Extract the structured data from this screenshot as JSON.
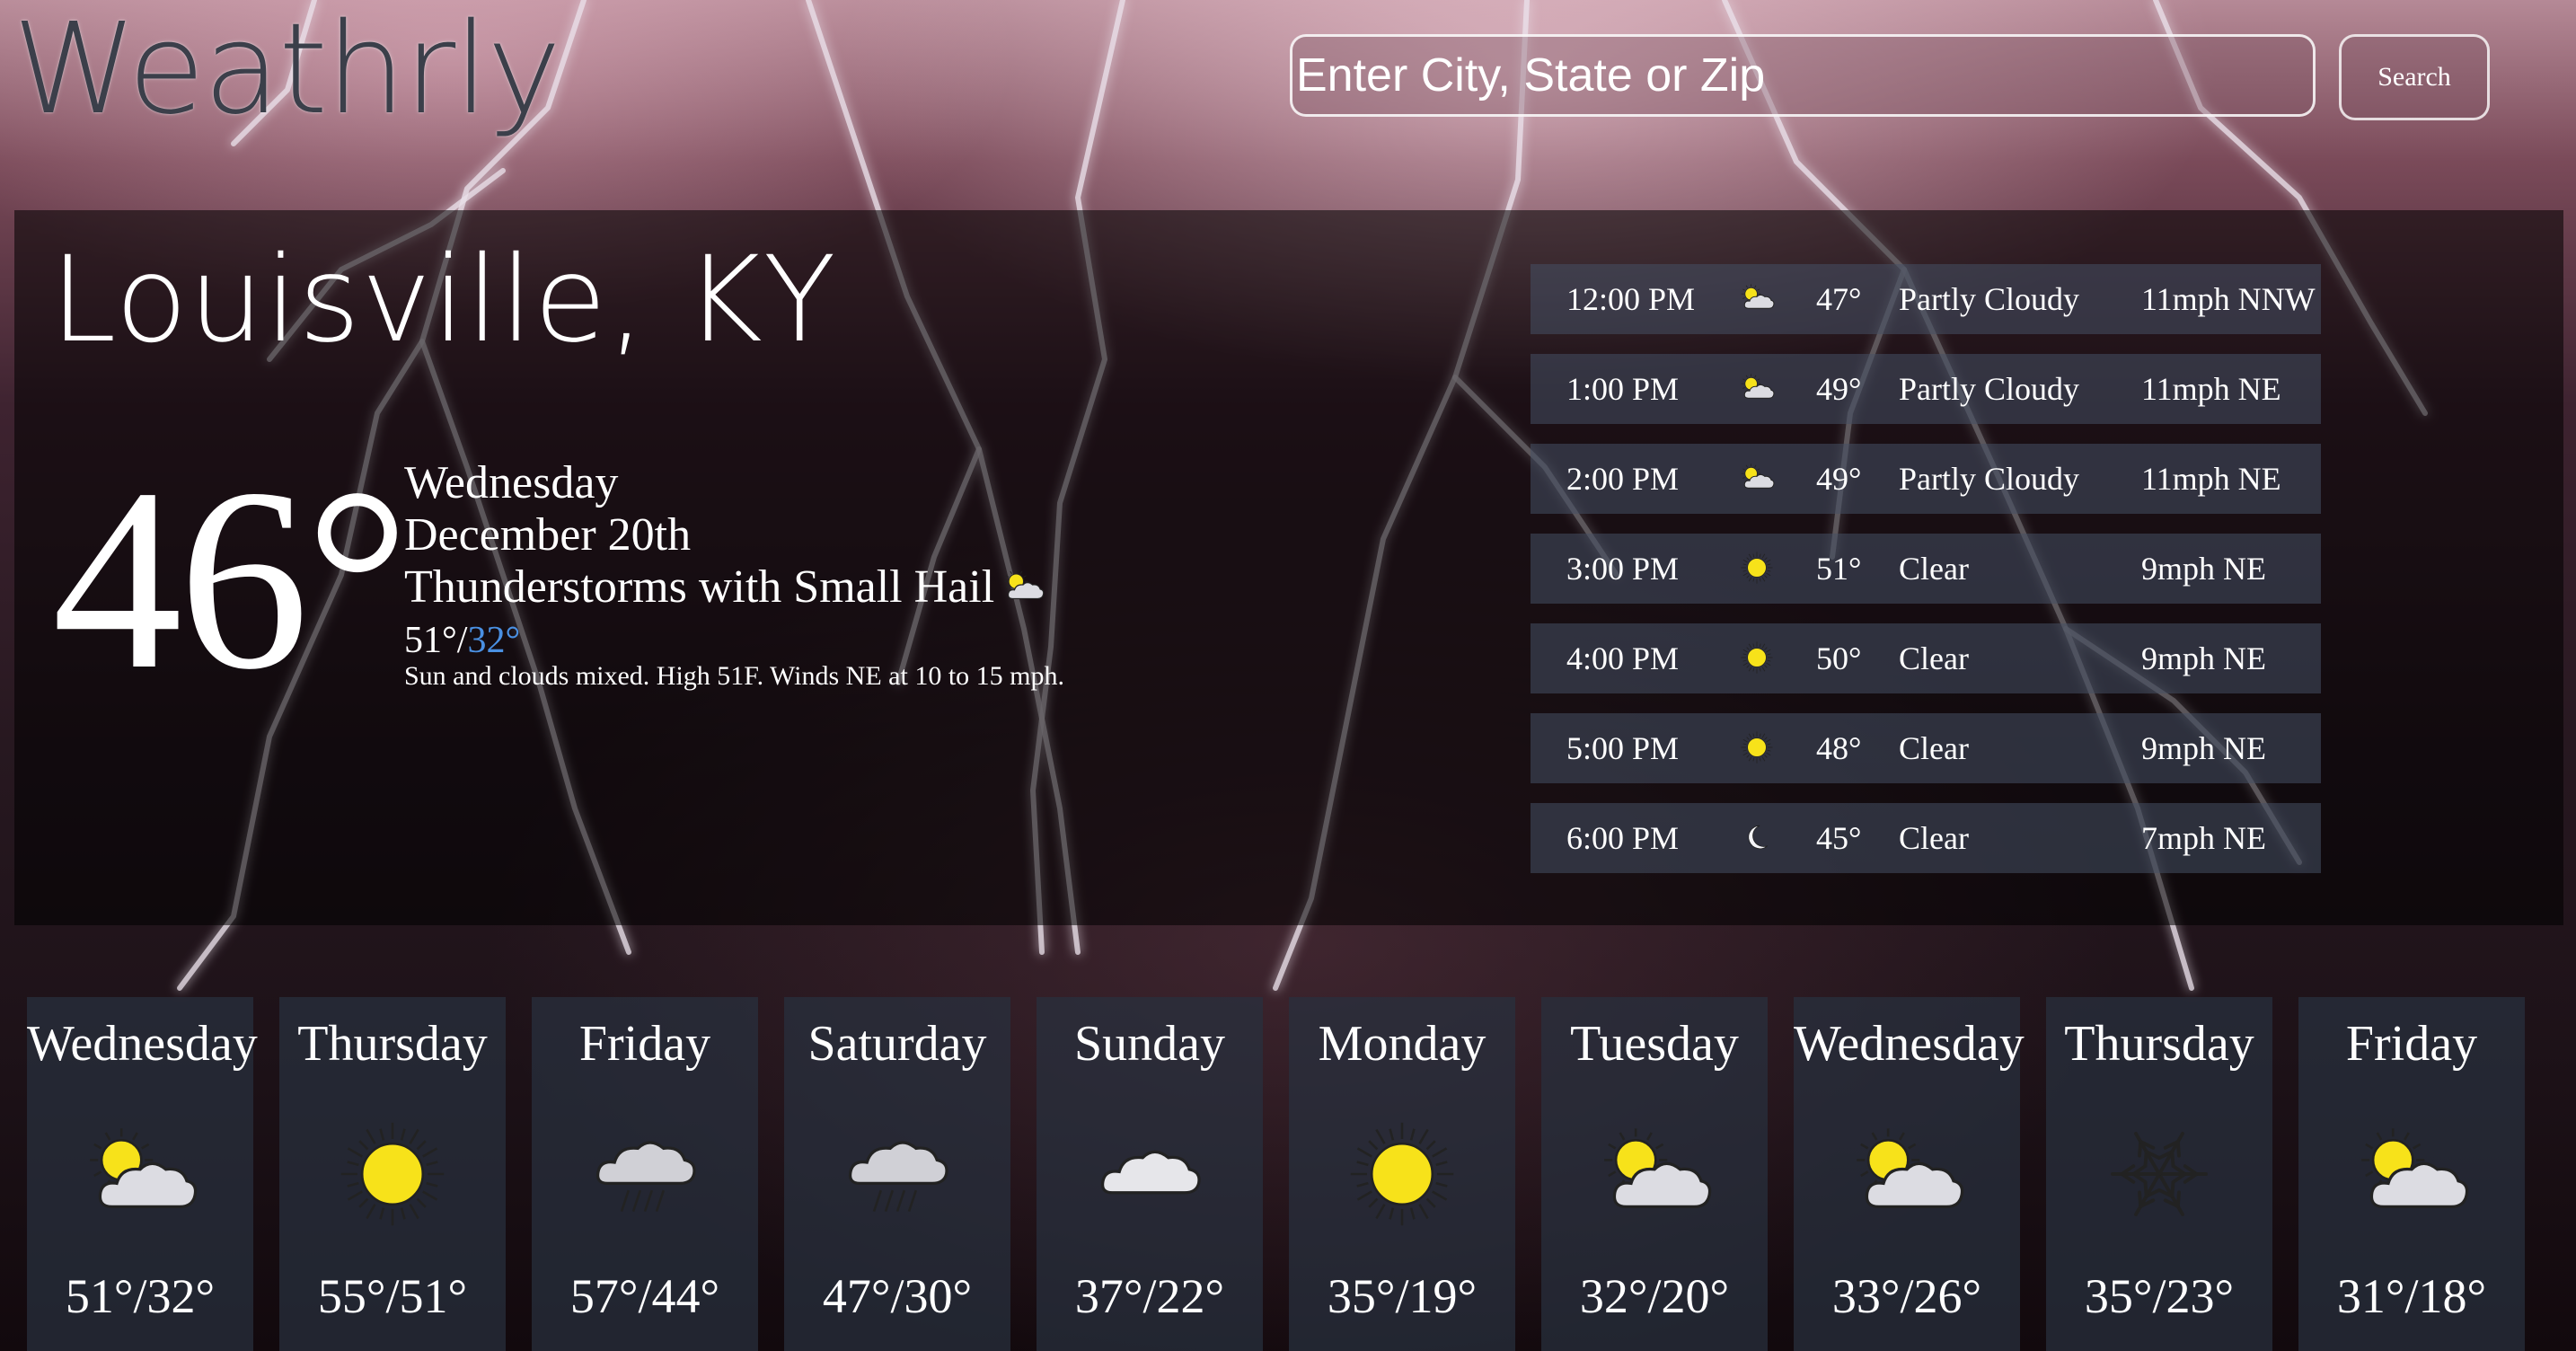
{
  "app": {
    "logo": "Weathrly"
  },
  "search": {
    "placeholder": "Enter City, State or Zip",
    "button_label": "Search"
  },
  "current": {
    "city": "Louisville, KY",
    "temp": "46°",
    "day": "Wednesday",
    "date": "December 20th",
    "condition": "Thunderstorms with Small Hail",
    "condition_icon": "partly-cloudy-icon",
    "high": "51°",
    "separator": "/",
    "low": "32°",
    "summary": "Sun and clouds mixed. High 51F. Winds NE at 10 to 15 mph.",
    "low_color": "#4a90e2"
  },
  "hourly": [
    {
      "time": "12:00 PM",
      "icon": "partly-cloudy-icon",
      "temp": "47°",
      "condition": "Partly Cloudy",
      "wind": "11mph NNW"
    },
    {
      "time": "1:00 PM",
      "icon": "partly-cloudy-icon",
      "temp": "49°",
      "condition": "Partly Cloudy",
      "wind": "11mph NE"
    },
    {
      "time": "2:00 PM",
      "icon": "partly-cloudy-icon",
      "temp": "49°",
      "condition": "Partly Cloudy",
      "wind": "11mph NE"
    },
    {
      "time": "3:00 PM",
      "icon": "sun-icon",
      "temp": "51°",
      "condition": "Clear",
      "wind": "9mph NE"
    },
    {
      "time": "4:00 PM",
      "icon": "sun-icon",
      "temp": "50°",
      "condition": "Clear",
      "wind": "9mph NE"
    },
    {
      "time": "5:00 PM",
      "icon": "sun-icon",
      "temp": "48°",
      "condition": "Clear",
      "wind": "9mph NE"
    },
    {
      "time": "6:00 PM",
      "icon": "moon-icon",
      "temp": "45°",
      "condition": "Clear",
      "wind": "7mph NE"
    }
  ],
  "daily": [
    {
      "day": "Wednesday",
      "icon": "partly-cloudy-icon",
      "temps": "51°/32°"
    },
    {
      "day": "Thursday",
      "icon": "sun-icon",
      "temps": "55°/51°"
    },
    {
      "day": "Friday",
      "icon": "rain-icon",
      "temps": "57°/44°"
    },
    {
      "day": "Saturday",
      "icon": "rain-icon",
      "temps": "47°/30°"
    },
    {
      "day": "Sunday",
      "icon": "cloud-icon",
      "temps": "37°/22°"
    },
    {
      "day": "Monday",
      "icon": "sun-icon",
      "temps": "35°/19°"
    },
    {
      "day": "Tuesday",
      "icon": "partly-cloudy-icon",
      "temps": "32°/20°"
    },
    {
      "day": "Wednesday",
      "icon": "partly-cloudy-icon",
      "temps": "33°/26°"
    },
    {
      "day": "Thursday",
      "icon": "snow-icon",
      "temps": "35°/23°"
    },
    {
      "day": "Friday",
      "icon": "partly-cloudy-icon",
      "temps": "31°/18°"
    }
  ]
}
